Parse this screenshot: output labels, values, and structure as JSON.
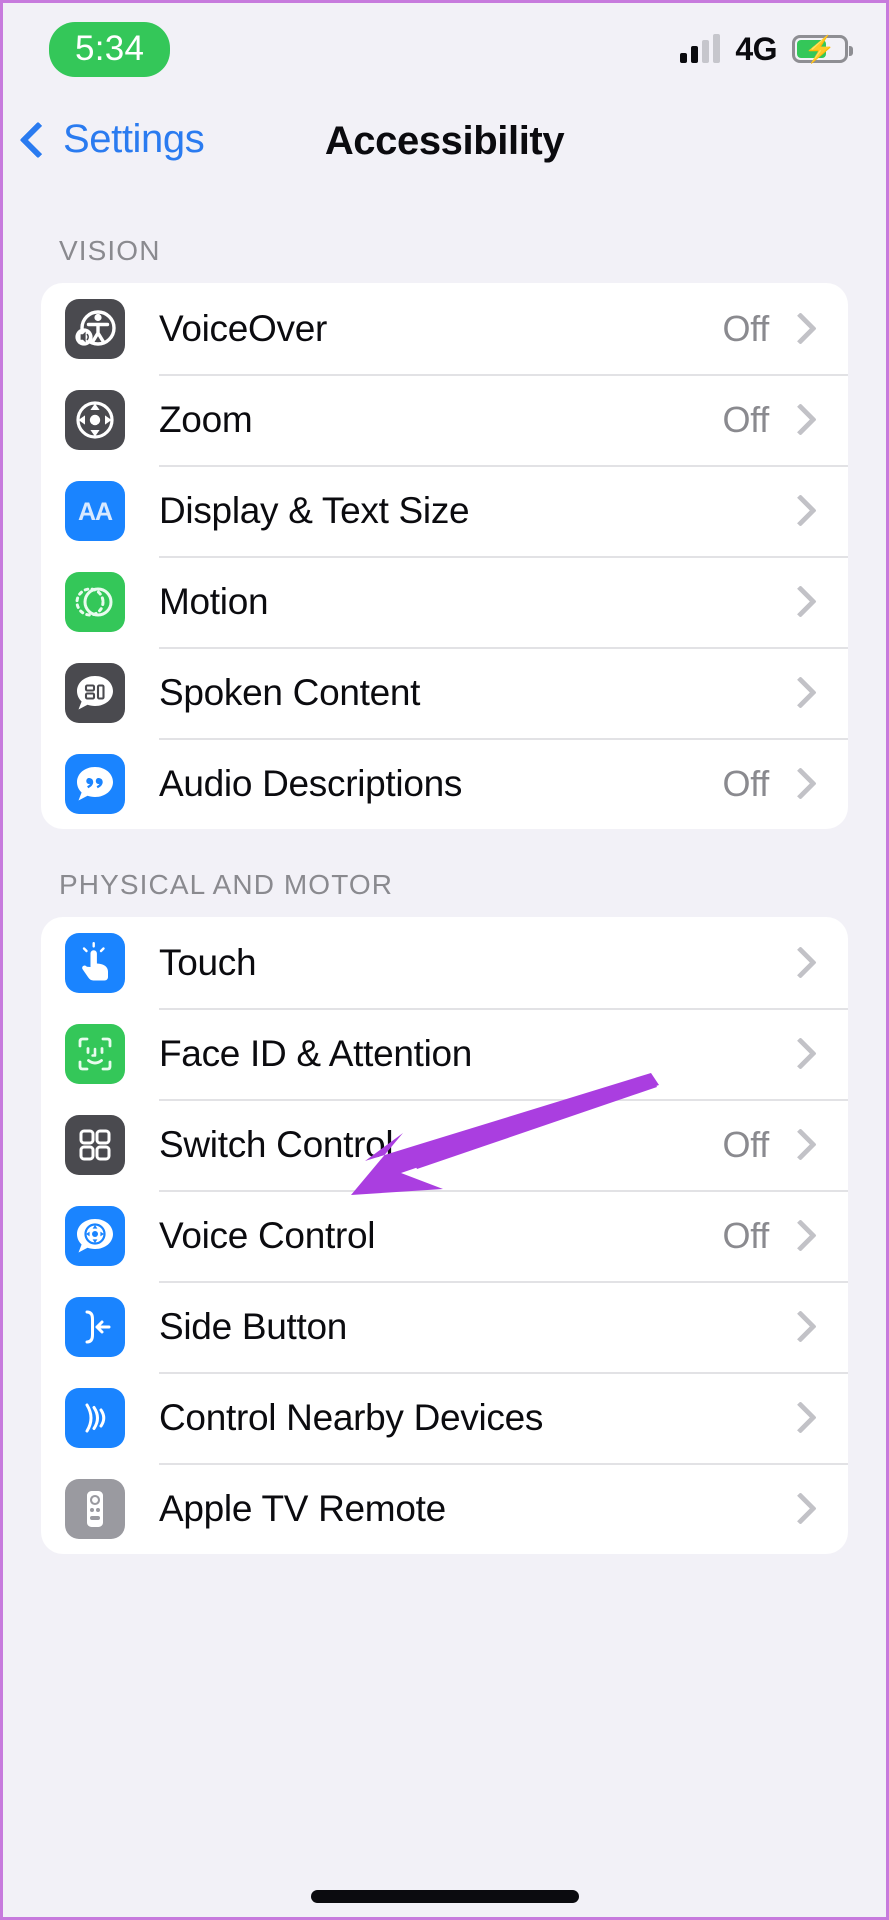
{
  "status_bar": {
    "time": "5:34",
    "network": "4G",
    "signal_icon": "cellular-signal-icon",
    "battery_icon": "battery-charging-icon",
    "battery_level_percent": 58
  },
  "nav": {
    "back_label": "Settings",
    "back_icon": "chevron-left-icon",
    "title": "Accessibility"
  },
  "colors": {
    "accent_blue": "#2a7bf0",
    "icon_blue": "#1a84ff",
    "icon_green": "#34c759",
    "icon_gray": "#4a4a4f",
    "icon_silver": "#9a9aa0",
    "page_background": "#f2f1f7",
    "card_background": "#ffffff",
    "annotation_purple": "#aa3ee0"
  },
  "sections": [
    {
      "header": "VISION",
      "rows": [
        {
          "label": "VoiceOver",
          "value": "Off",
          "icon": "voiceover-icon",
          "icon_color": "#4a4a4f"
        },
        {
          "label": "Zoom",
          "value": "Off",
          "icon": "zoom-icon",
          "icon_color": "#4a4a4f"
        },
        {
          "label": "Display & Text Size",
          "value": "",
          "icon": "display-text-size-icon",
          "icon_color": "#1a84ff"
        },
        {
          "label": "Motion",
          "value": "",
          "icon": "motion-icon",
          "icon_color": "#34c759"
        },
        {
          "label": "Spoken Content",
          "value": "",
          "icon": "spoken-content-icon",
          "icon_color": "#4a4a4f"
        },
        {
          "label": "Audio Descriptions",
          "value": "Off",
          "icon": "audio-descriptions-icon",
          "icon_color": "#1a84ff"
        }
      ]
    },
    {
      "header": "PHYSICAL AND MOTOR",
      "rows": [
        {
          "label": "Touch",
          "value": "",
          "icon": "touch-icon",
          "icon_color": "#1a84ff"
        },
        {
          "label": "Face ID & Attention",
          "value": "",
          "icon": "face-id-icon",
          "icon_color": "#34c759"
        },
        {
          "label": "Switch Control",
          "value": "Off",
          "icon": "switch-control-icon",
          "icon_color": "#4a4a4f"
        },
        {
          "label": "Voice Control",
          "value": "Off",
          "icon": "voice-control-icon",
          "icon_color": "#1a84ff"
        },
        {
          "label": "Side Button",
          "value": "",
          "icon": "side-button-icon",
          "icon_color": "#1a84ff"
        },
        {
          "label": "Control Nearby Devices",
          "value": "",
          "icon": "control-nearby-devices-icon",
          "icon_color": "#1a84ff"
        },
        {
          "label": "Apple TV Remote",
          "value": "",
          "icon": "apple-tv-remote-icon",
          "icon_color": "#9a9aa0"
        }
      ]
    }
  ],
  "annotation": {
    "type": "arrow",
    "color": "#aa3ee0",
    "points_to": "Touch"
  }
}
